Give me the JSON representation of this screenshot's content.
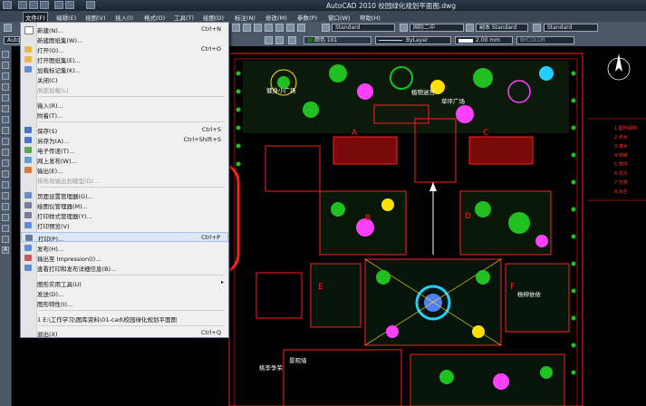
{
  "window": {
    "title": "AutoCAD 2010    校园绿化规划平面图.dwg"
  },
  "menubar": {
    "items": [
      "文件(F)",
      "编辑(E)",
      "视图(V)",
      "插入(I)",
      "格式(O)",
      "工具(T)",
      "绘图(D)",
      "标注(N)",
      "修改(M)",
      "参数(P)",
      "窗口(W)",
      "帮助(H)"
    ],
    "active_index": 0
  },
  "toolbar1": {
    "style_combo": "Standard",
    "dim_style_combo": "国际二中",
    "copy_combo": "副本 Standard",
    "table_style_combo": "Standard"
  },
  "toolbar2": {
    "workspace_combo": "Auto",
    "color_combo": "颜色 101",
    "linetype_combo": "ByLayer",
    "lineweight_combo": "2.00 mm",
    "plotstyle_combo": "BYCOLOR"
  },
  "file_menu": {
    "items": [
      {
        "label": "新建(N)...",
        "shortcut": "Ctrl+N",
        "icon": "new-icon",
        "color": "#ffffff",
        "disabled": false
      },
      {
        "label": "新建图纸集(W)...",
        "shortcut": "",
        "icon": "",
        "disabled": false
      },
      {
        "label": "打开(O)...",
        "shortcut": "Ctrl+O",
        "icon": "open-icon",
        "color": "#e8b84a",
        "disabled": false
      },
      {
        "label": "打开图纸集(E)...",
        "shortcut": "",
        "icon": "open-sheetset-icon",
        "color": "#e8b84a",
        "disabled": false
      },
      {
        "label": "加载标记集(K)...",
        "shortcut": "",
        "icon": "markup-icon",
        "color": "#5a8fd8",
        "disabled": false
      },
      {
        "label": "关闭(C)",
        "shortcut": "",
        "icon": "",
        "disabled": false
      },
      {
        "label": "局部加载(L)",
        "shortcut": "",
        "icon": "",
        "disabled": true
      },
      {
        "label": "输入(R)...",
        "shortcut": "",
        "icon": "",
        "disabled": false
      },
      {
        "label": "附着(T)...",
        "shortcut": "",
        "icon": "",
        "disabled": false
      },
      {
        "label": "保存(S)",
        "shortcut": "Ctrl+S",
        "icon": "save-icon",
        "color": "#4a72c8",
        "disabled": false
      },
      {
        "label": "另存为(A)...",
        "shortcut": "Ctrl+Shift+S",
        "icon": "save-as-icon",
        "color": "#4a72c8",
        "disabled": false
      },
      {
        "label": "电子传递(T)...",
        "shortcut": "",
        "icon": "etransmit-icon",
        "color": "#58a858",
        "disabled": false
      },
      {
        "label": "网上发布(W)...",
        "shortcut": "",
        "icon": "publish-web-icon",
        "color": "#58a0d8",
        "disabled": false
      },
      {
        "label": "输出(E)...",
        "shortcut": "",
        "icon": "export-icon",
        "color": "#d87a3a",
        "disabled": false
      },
      {
        "label": "将布局输出到模型(D)...",
        "shortcut": "",
        "icon": "",
        "disabled": true
      },
      {
        "label": "页面设置管理器(G)...",
        "shortcut": "",
        "icon": "page-setup-icon",
        "color": "#6a8ac8",
        "disabled": false
      },
      {
        "label": "绘图仪管理器(M)...",
        "shortcut": "",
        "icon": "plotter-icon",
        "color": "#7a7a9a",
        "disabled": false
      },
      {
        "label": "打印样式管理器(Y)...",
        "shortcut": "",
        "icon": "plot-style-icon",
        "color": "#7a7a9a",
        "disabled": false
      },
      {
        "label": "打印预览(V)",
        "shortcut": "",
        "icon": "plot-preview-icon",
        "color": "#5a8fd8",
        "disabled": false
      },
      {
        "label": "打印(P)...",
        "shortcut": "Ctrl+P",
        "icon": "print-icon",
        "color": "#6a7a9a",
        "disabled": false
      },
      {
        "label": "发布(H)...",
        "shortcut": "",
        "icon": "publish-icon",
        "color": "#5a8fd8",
        "disabled": false
      },
      {
        "label": "输出至 Impression(I)...",
        "shortcut": "",
        "icon": "impression-icon",
        "color": "#c85a5a",
        "disabled": false
      },
      {
        "label": "查看打印和发布详细信息(B)...",
        "shortcut": "",
        "icon": "plot-details-icon",
        "color": "#5a8fd8",
        "disabled": false
      },
      {
        "label": "图形实用工具(U)",
        "shortcut": "",
        "icon": "",
        "submenu": true,
        "disabled": false
      },
      {
        "label": "发送(D)...",
        "shortcut": "",
        "icon": "",
        "disabled": false
      },
      {
        "label": "图形特性(I)...",
        "shortcut": "",
        "icon": "",
        "disabled": false
      },
      {
        "label": "1 E:\\工作学习\\图库资料\\01-cad\\校园绿化规划平面图",
        "shortcut": "",
        "icon": "",
        "disabled": false
      },
      {
        "label": "退出(X)",
        "shortcut": "Ctrl+Q",
        "icon": "",
        "disabled": false
      }
    ],
    "hover_index": 19
  },
  "drawing": {
    "labels": [
      "健身小广场",
      "植物迷宫",
      "草坪广场",
      "景观墙",
      "桃李争荣",
      "杨柳依依"
    ],
    "letters": [
      "A",
      "B",
      "C",
      "D",
      "E",
      "F"
    ],
    "red_notes": [
      "1.图例说明",
      "2.乔木",
      "3.灌木",
      "4.地被",
      "5.草坪",
      "6.花卉",
      "7.竹类",
      "8.水生"
    ],
    "colors": {
      "red": "#ff2020",
      "green": "#20c020",
      "yellow": "#ffe000",
      "magenta": "#ff40ff",
      "cyan": "#20d0ff"
    }
  }
}
